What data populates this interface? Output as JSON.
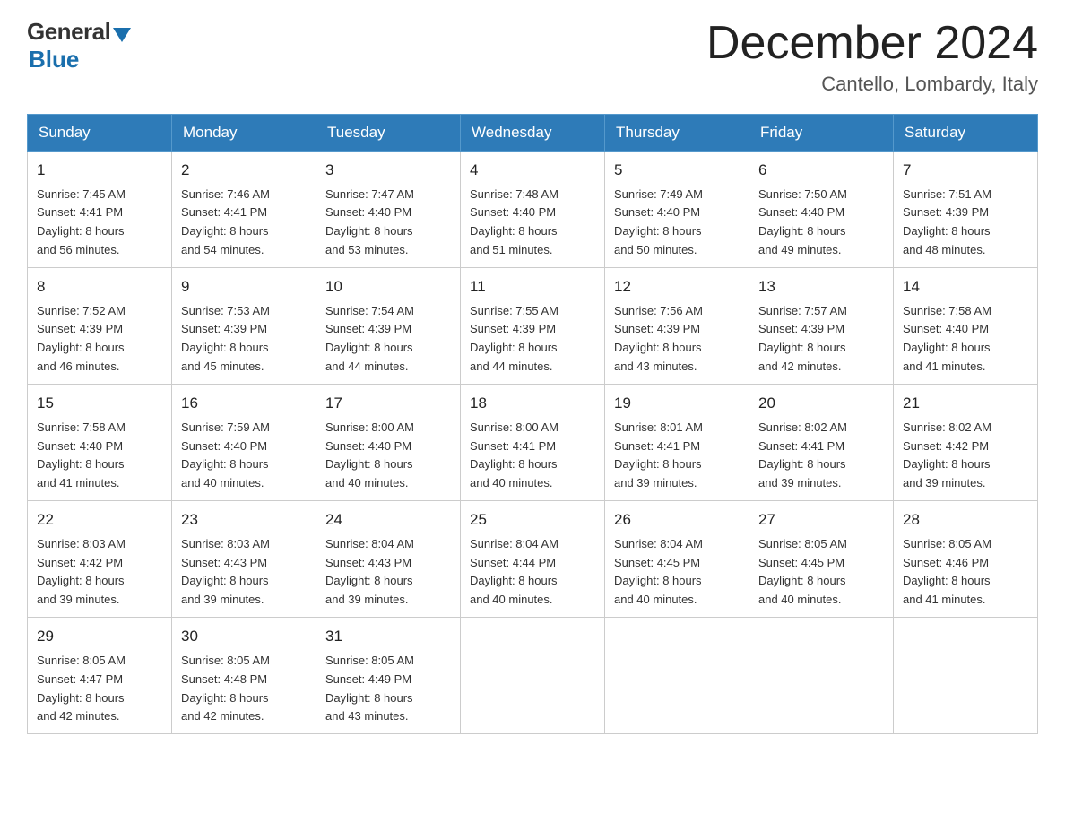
{
  "logo": {
    "general": "General",
    "blue": "Blue"
  },
  "header": {
    "month_title": "December 2024",
    "location": "Cantello, Lombardy, Italy"
  },
  "weekdays": [
    "Sunday",
    "Monday",
    "Tuesday",
    "Wednesday",
    "Thursday",
    "Friday",
    "Saturday"
  ],
  "weeks": [
    [
      {
        "day": "1",
        "sunrise": "7:45 AM",
        "sunset": "4:41 PM",
        "daylight": "8 hours and 56 minutes."
      },
      {
        "day": "2",
        "sunrise": "7:46 AM",
        "sunset": "4:41 PM",
        "daylight": "8 hours and 54 minutes."
      },
      {
        "day": "3",
        "sunrise": "7:47 AM",
        "sunset": "4:40 PM",
        "daylight": "8 hours and 53 minutes."
      },
      {
        "day": "4",
        "sunrise": "7:48 AM",
        "sunset": "4:40 PM",
        "daylight": "8 hours and 51 minutes."
      },
      {
        "day": "5",
        "sunrise": "7:49 AM",
        "sunset": "4:40 PM",
        "daylight": "8 hours and 50 minutes."
      },
      {
        "day": "6",
        "sunrise": "7:50 AM",
        "sunset": "4:40 PM",
        "daylight": "8 hours and 49 minutes."
      },
      {
        "day": "7",
        "sunrise": "7:51 AM",
        "sunset": "4:39 PM",
        "daylight": "8 hours and 48 minutes."
      }
    ],
    [
      {
        "day": "8",
        "sunrise": "7:52 AM",
        "sunset": "4:39 PM",
        "daylight": "8 hours and 46 minutes."
      },
      {
        "day": "9",
        "sunrise": "7:53 AM",
        "sunset": "4:39 PM",
        "daylight": "8 hours and 45 minutes."
      },
      {
        "day": "10",
        "sunrise": "7:54 AM",
        "sunset": "4:39 PM",
        "daylight": "8 hours and 44 minutes."
      },
      {
        "day": "11",
        "sunrise": "7:55 AM",
        "sunset": "4:39 PM",
        "daylight": "8 hours and 44 minutes."
      },
      {
        "day": "12",
        "sunrise": "7:56 AM",
        "sunset": "4:39 PM",
        "daylight": "8 hours and 43 minutes."
      },
      {
        "day": "13",
        "sunrise": "7:57 AM",
        "sunset": "4:39 PM",
        "daylight": "8 hours and 42 minutes."
      },
      {
        "day": "14",
        "sunrise": "7:58 AM",
        "sunset": "4:40 PM",
        "daylight": "8 hours and 41 minutes."
      }
    ],
    [
      {
        "day": "15",
        "sunrise": "7:58 AM",
        "sunset": "4:40 PM",
        "daylight": "8 hours and 41 minutes."
      },
      {
        "day": "16",
        "sunrise": "7:59 AM",
        "sunset": "4:40 PM",
        "daylight": "8 hours and 40 minutes."
      },
      {
        "day": "17",
        "sunrise": "8:00 AM",
        "sunset": "4:40 PM",
        "daylight": "8 hours and 40 minutes."
      },
      {
        "day": "18",
        "sunrise": "8:00 AM",
        "sunset": "4:41 PM",
        "daylight": "8 hours and 40 minutes."
      },
      {
        "day": "19",
        "sunrise": "8:01 AM",
        "sunset": "4:41 PM",
        "daylight": "8 hours and 39 minutes."
      },
      {
        "day": "20",
        "sunrise": "8:02 AM",
        "sunset": "4:41 PM",
        "daylight": "8 hours and 39 minutes."
      },
      {
        "day": "21",
        "sunrise": "8:02 AM",
        "sunset": "4:42 PM",
        "daylight": "8 hours and 39 minutes."
      }
    ],
    [
      {
        "day": "22",
        "sunrise": "8:03 AM",
        "sunset": "4:42 PM",
        "daylight": "8 hours and 39 minutes."
      },
      {
        "day": "23",
        "sunrise": "8:03 AM",
        "sunset": "4:43 PM",
        "daylight": "8 hours and 39 minutes."
      },
      {
        "day": "24",
        "sunrise": "8:04 AM",
        "sunset": "4:43 PM",
        "daylight": "8 hours and 39 minutes."
      },
      {
        "day": "25",
        "sunrise": "8:04 AM",
        "sunset": "4:44 PM",
        "daylight": "8 hours and 40 minutes."
      },
      {
        "day": "26",
        "sunrise": "8:04 AM",
        "sunset": "4:45 PM",
        "daylight": "8 hours and 40 minutes."
      },
      {
        "day": "27",
        "sunrise": "8:05 AM",
        "sunset": "4:45 PM",
        "daylight": "8 hours and 40 minutes."
      },
      {
        "day": "28",
        "sunrise": "8:05 AM",
        "sunset": "4:46 PM",
        "daylight": "8 hours and 41 minutes."
      }
    ],
    [
      {
        "day": "29",
        "sunrise": "8:05 AM",
        "sunset": "4:47 PM",
        "daylight": "8 hours and 42 minutes."
      },
      {
        "day": "30",
        "sunrise": "8:05 AM",
        "sunset": "4:48 PM",
        "daylight": "8 hours and 42 minutes."
      },
      {
        "day": "31",
        "sunrise": "8:05 AM",
        "sunset": "4:49 PM",
        "daylight": "8 hours and 43 minutes."
      },
      null,
      null,
      null,
      null
    ]
  ],
  "labels": {
    "sunrise": "Sunrise:",
    "sunset": "Sunset:",
    "daylight": "Daylight:"
  }
}
